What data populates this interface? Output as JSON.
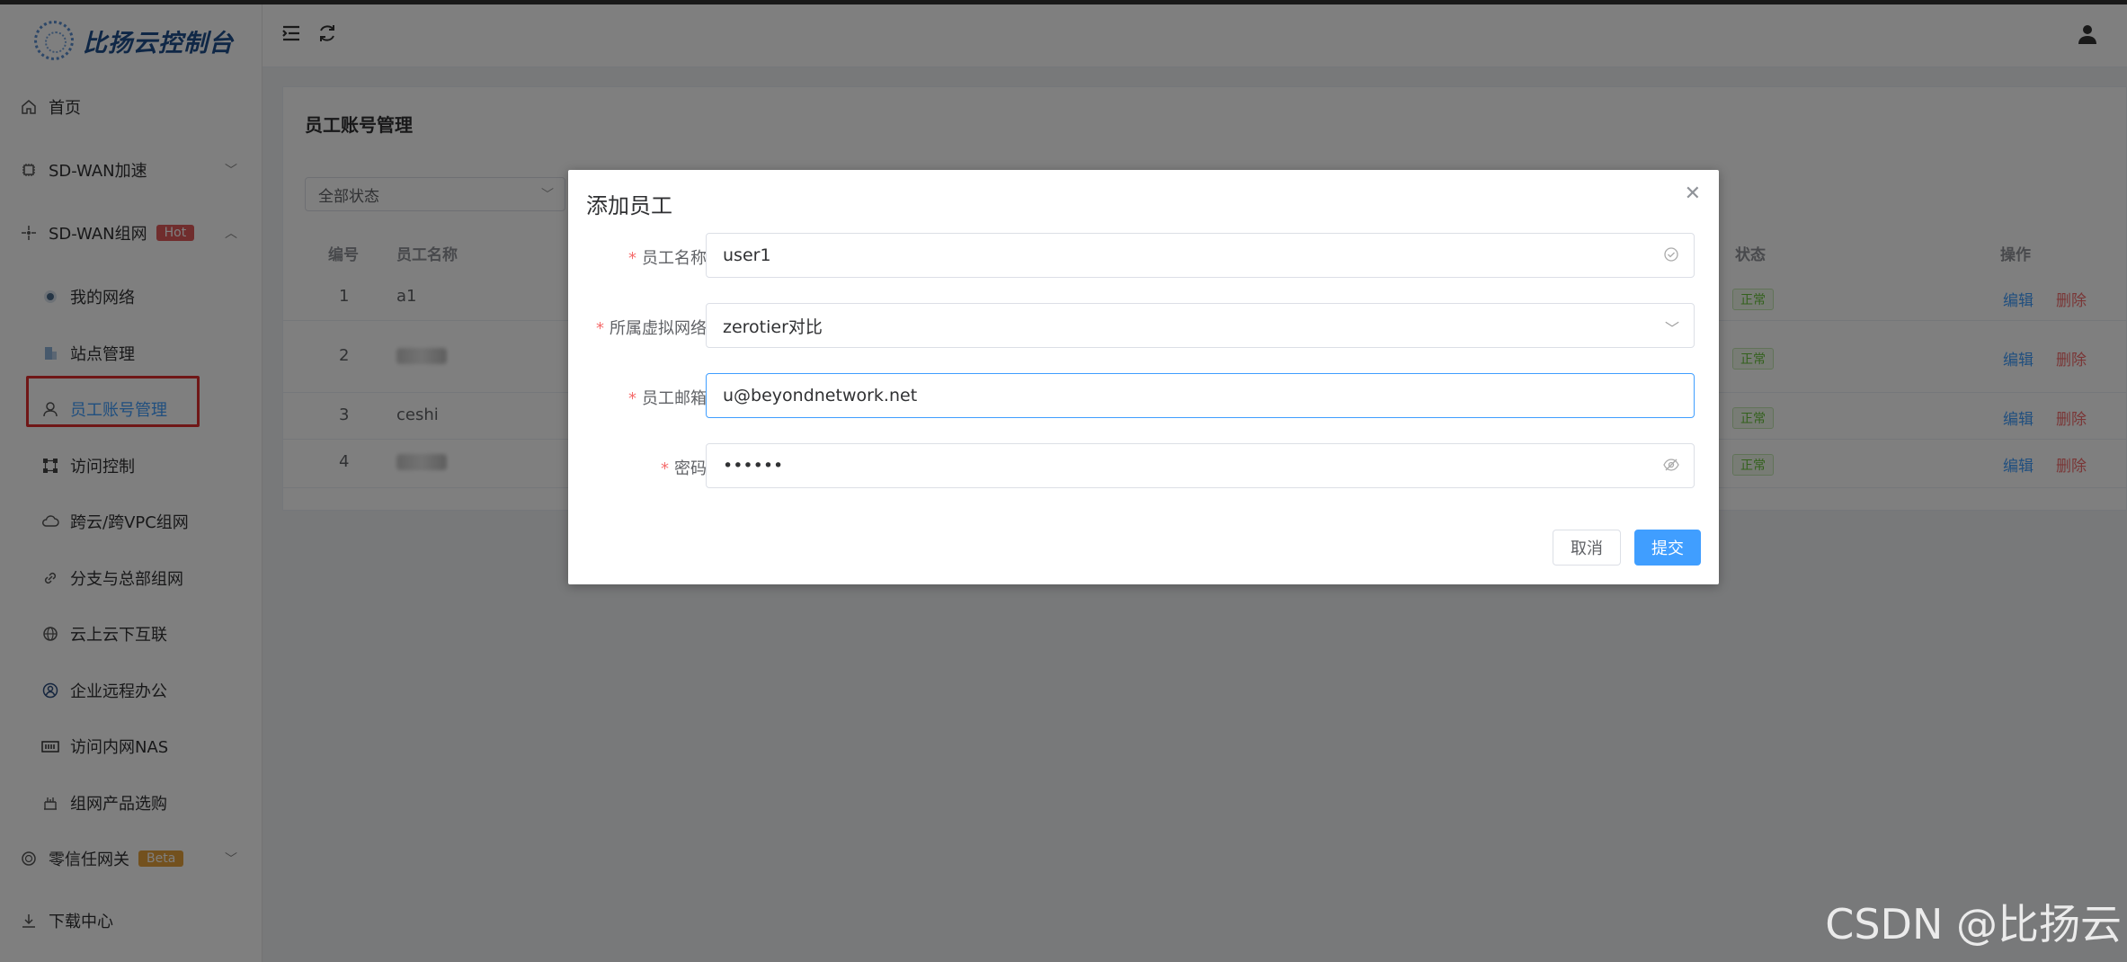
{
  "sidebar": {
    "logo_text": "比扬云控制台",
    "items": [
      {
        "label": "首页",
        "icon": "home-icon"
      },
      {
        "label": "SD-WAN加速",
        "icon": "chip-icon"
      },
      {
        "label": "SD-WAN组网",
        "icon": "network-icon",
        "badge": "Hot"
      },
      {
        "label": "我的网络",
        "icon": "dot-icon"
      },
      {
        "label": "站点管理",
        "icon": "building-icon"
      },
      {
        "label": "员工账号管理",
        "icon": "user-icon"
      },
      {
        "label": "访问控制",
        "icon": "nodes-icon"
      },
      {
        "label": "跨云/跨VPC组网",
        "icon": "cloud-icon"
      },
      {
        "label": "分支与总部组网",
        "icon": "link-icon"
      },
      {
        "label": "云上云下互联",
        "icon": "globe-icon"
      },
      {
        "label": "企业远程办公",
        "icon": "person-circle-icon"
      },
      {
        "label": "访问内网NAS",
        "icon": "nas-icon"
      },
      {
        "label": "组网产品选购",
        "icon": "shop-icon"
      },
      {
        "label": "零信任网关",
        "icon": "shield-icon",
        "badge": "Beta"
      },
      {
        "label": "下载中心",
        "icon": "download-icon"
      }
    ]
  },
  "page": {
    "title": "员工账号管理",
    "filter_value": "全部状态",
    "columns": {
      "id": "编号",
      "name": "员工名称",
      "status": "状态",
      "actions": "操作"
    },
    "rows": [
      {
        "id": "1",
        "name": "a1",
        "status": "正常",
        "edit": "编辑",
        "delete": "删除"
      },
      {
        "id": "2",
        "name": "",
        "status": "正常",
        "edit": "编辑",
        "delete": "删除"
      },
      {
        "id": "3",
        "name": "ceshi",
        "status": "正常",
        "edit": "编辑",
        "delete": "删除"
      },
      {
        "id": "4",
        "name": "",
        "status": "正常",
        "edit": "编辑",
        "delete": "删除"
      }
    ]
  },
  "dialog": {
    "title": "添加员工",
    "fields": {
      "name_label": "员工名称",
      "name_value": "user1",
      "network_label": "所属虚拟网络",
      "network_value": "zerotier对比",
      "email_label": "员工邮箱",
      "email_value": "u@beyondnetwork.net",
      "password_label": "密码",
      "password_value": "••••••"
    },
    "cancel_label": "取消",
    "submit_label": "提交"
  },
  "watermark": "CSDN @比扬云",
  "colors": {
    "primary": "#409eff",
    "danger": "#f56c6c",
    "success": "#67c23a",
    "hot": "#e05a5a",
    "beta": "#e6a23c"
  }
}
